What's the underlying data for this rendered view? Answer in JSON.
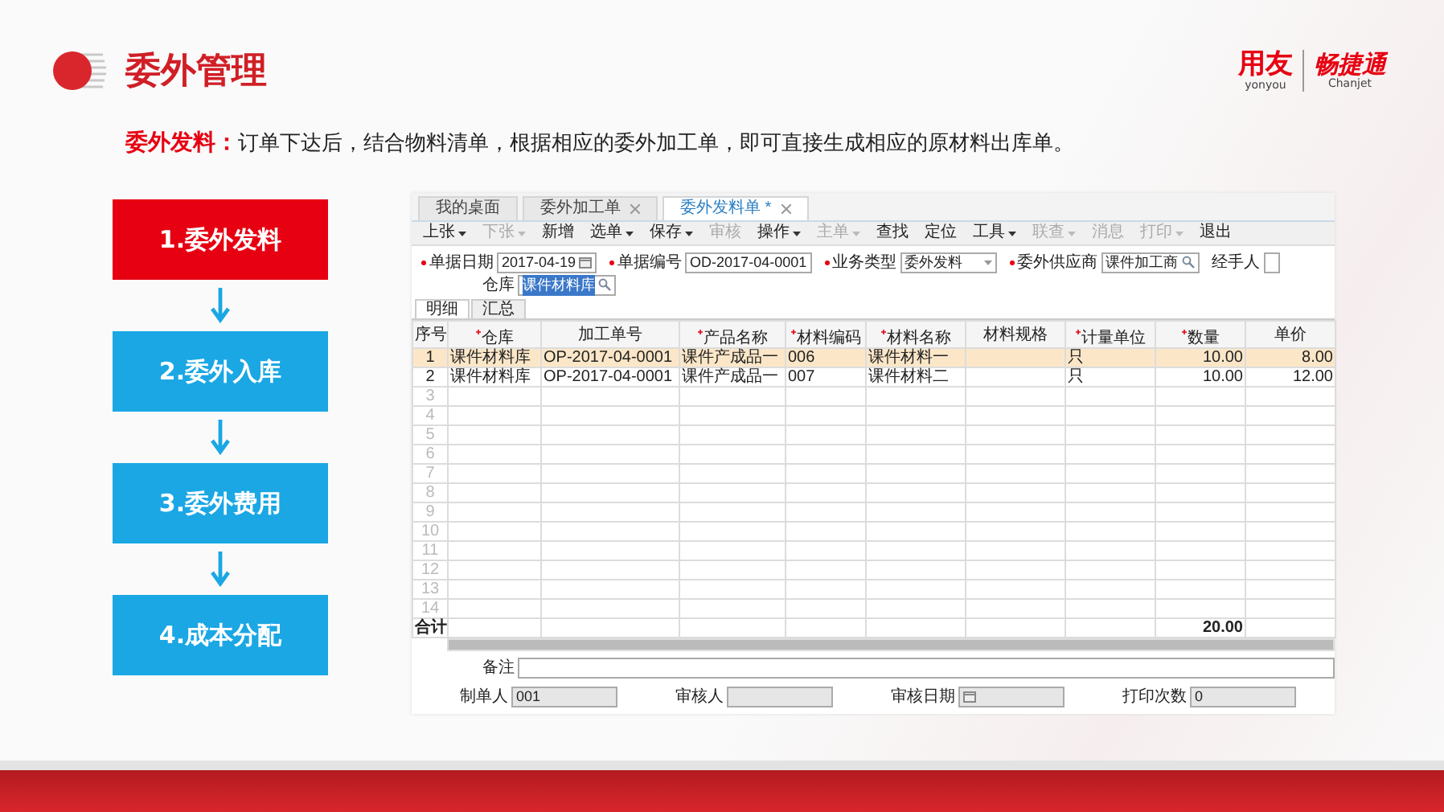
{
  "header": {
    "title": "委外管理",
    "logo": {
      "brand": "用友",
      "brand_sub": "yonyou",
      "product": "畅捷通",
      "product_sub": "Chanjet"
    }
  },
  "description": {
    "lead": "委外发料：",
    "text": "订单下达后，结合物料清单，根据相应的委外加工单，即可直接生成相应的原材料出库单。"
  },
  "steps": [
    {
      "label": "1.委外发料",
      "selected": true
    },
    {
      "label": "2.委外入库",
      "selected": false
    },
    {
      "label": "3.委外费用",
      "selected": false
    },
    {
      "label": "4.成本分配",
      "selected": false
    }
  ],
  "app": {
    "tabs": [
      {
        "label": "我的桌面",
        "selected": false,
        "closable": false
      },
      {
        "label": "委外加工单",
        "selected": false,
        "closable": true
      },
      {
        "label": "委外发料单 *",
        "selected": true,
        "closable": true
      }
    ],
    "toolbar": [
      {
        "label": "上张",
        "dropdown": true,
        "disabled": false
      },
      {
        "label": "下张",
        "dropdown": true,
        "disabled": true
      },
      {
        "label": "新增",
        "dropdown": false,
        "disabled": false
      },
      {
        "label": "选单",
        "dropdown": true,
        "disabled": false
      },
      {
        "label": "保存",
        "dropdown": true,
        "disabled": false
      },
      {
        "label": "审核",
        "dropdown": false,
        "disabled": true
      },
      {
        "label": "操作",
        "dropdown": true,
        "disabled": false
      },
      {
        "label": "主单",
        "dropdown": true,
        "disabled": true
      },
      {
        "label": "查找",
        "dropdown": false,
        "disabled": false
      },
      {
        "label": "定位",
        "dropdown": false,
        "disabled": false
      },
      {
        "label": "工具",
        "dropdown": true,
        "disabled": false
      },
      {
        "label": "联查",
        "dropdown": true,
        "disabled": true
      },
      {
        "label": "消息",
        "dropdown": false,
        "disabled": true
      },
      {
        "label": "打印",
        "dropdown": true,
        "disabled": true
      },
      {
        "label": "退出",
        "dropdown": false,
        "disabled": false
      }
    ],
    "form_rows": [
      [
        {
          "label": "单据日期",
          "required": true,
          "kind": "date",
          "value": "2017-04-19"
        },
        {
          "label": "单据编号",
          "required": true,
          "kind": "text",
          "value": "OD-2017-04-0001"
        },
        {
          "label": "业务类型",
          "required": true,
          "kind": "select",
          "value": "委外发料"
        },
        {
          "label": "委外供应商",
          "required": true,
          "kind": "lookup",
          "value": "课件加工商"
        },
        {
          "label": "经手人",
          "required": false,
          "kind": "text"
        }
      ],
      [
        {
          "label": "仓库",
          "required": false,
          "kind": "lookup",
          "value": "课件材料库",
          "highlighted": true
        }
      ]
    ],
    "subtabs": [
      {
        "label": "明细",
        "selected": true
      },
      {
        "label": "汇总",
        "selected": false
      }
    ],
    "columns": [
      {
        "label": "序号",
        "required": false
      },
      {
        "label": "仓库",
        "required": true
      },
      {
        "label": "加工单号",
        "required": false
      },
      {
        "label": "产品名称",
        "required": true
      },
      {
        "label": "材料编码",
        "required": true
      },
      {
        "label": "材料名称",
        "required": true
      },
      {
        "label": "材料规格",
        "required": false
      },
      {
        "label": "计量单位",
        "required": true
      },
      {
        "label": "数量",
        "required": true
      },
      {
        "label": "单价",
        "required": false
      }
    ],
    "rows": [
      {
        "index": "1",
        "selected": true,
        "cells": [
          "课件材料库",
          "OP-2017-04-0001",
          "课件产成品一",
          "006",
          "课件材料一",
          null,
          "只",
          "10.00",
          "8.00"
        ]
      },
      {
        "index": "2",
        "selected": false,
        "cells": [
          "课件材料库",
          "OP-2017-04-0001",
          "课件产成品一",
          "007",
          "课件材料二",
          null,
          "只",
          "10.00",
          "12.00"
        ]
      },
      {
        "index": "3",
        "selected": false
      },
      {
        "index": "4",
        "selected": false
      },
      {
        "index": "5",
        "selected": false
      },
      {
        "index": "6",
        "selected": false
      },
      {
        "index": "7",
        "selected": false
      },
      {
        "index": "8",
        "selected": false
      },
      {
        "index": "9",
        "selected": false
      },
      {
        "index": "10",
        "selected": false
      },
      {
        "index": "11",
        "selected": false
      },
      {
        "index": "12",
        "selected": false
      },
      {
        "index": "13",
        "selected": false
      },
      {
        "index": "14",
        "selected": false
      }
    ],
    "total": {
      "label": "合计",
      "cells": [
        null,
        null,
        null,
        null,
        null,
        null,
        null,
        "20.00",
        null
      ]
    },
    "remark": {
      "label": "备注"
    },
    "footer_fields": [
      {
        "label": "制单人",
        "kind": "text",
        "value": "001"
      },
      {
        "label": "审核人",
        "kind": "text"
      },
      {
        "label": "审核日期",
        "kind": "date"
      },
      {
        "label": "打印次数",
        "kind": "text",
        "value": "0"
      }
    ]
  }
}
